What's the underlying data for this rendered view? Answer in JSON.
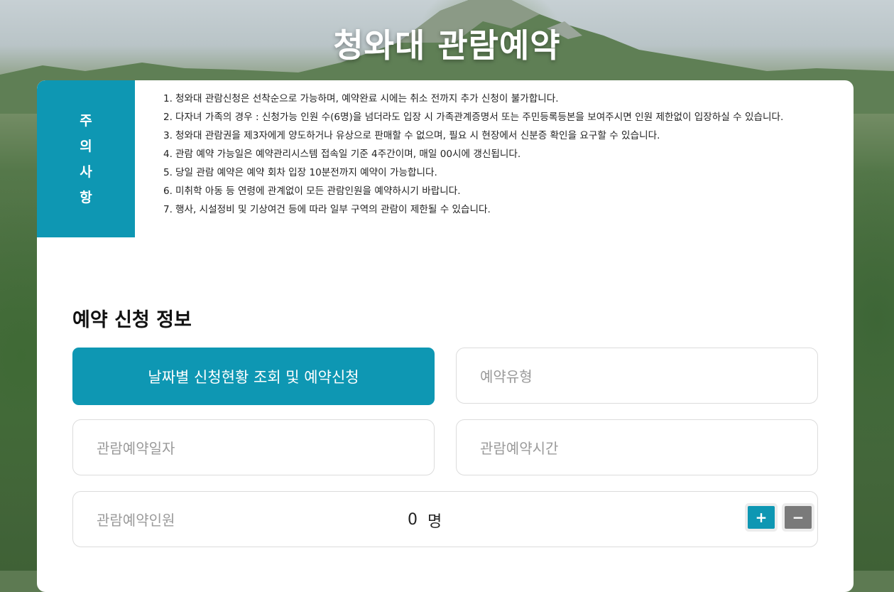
{
  "page": {
    "title": "청와대 관람예약"
  },
  "notice": {
    "tab_chars": [
      "주",
      "의",
      "사",
      "항"
    ],
    "items": [
      {
        "num": "1.",
        "text": "청와대 관람신청은 선착순으로 가능하며, 예약완료 시에는 취소 전까지 추가 신청이 불가합니다."
      },
      {
        "num": "2.",
        "text": "다자녀 가족의 경우 : 신청가능 인원 수(6명)을 넘더라도 입장 시 가족관계증명서 또는 주민등록등본을 보여주시면 인원 제한없이 입장하실 수 있습니다."
      },
      {
        "num": "3.",
        "text": "청와대 관람권을 제3자에게 양도하거나 유상으로 판매할 수 없으며, 필요 시 현장에서 신분증 확인을 요구할 수 있습니다."
      },
      {
        "num": "4.",
        "text": "관람 예약 가능일은 예약관리시스템 접속일 기준 4주간이며, 매일 00시에 갱신됩니다."
      },
      {
        "num": "5.",
        "text": "당일 관람 예약은 예약 회차 입장 10분전까지 예약이 가능합니다."
      },
      {
        "num": "6.",
        "text": "미취학 아동 등 연령에 관계없이 모든 관람인원을 예약하시기 바랍니다."
      },
      {
        "num": "7.",
        "text": "행사, 시설정비 및 기상여건 등에 따라 일부 구역의 관람이 제한될 수 있습니다."
      }
    ]
  },
  "form": {
    "section_title": "예약 신청 정보",
    "date_lookup_button": "날짜별 신청현황 조회 및 예약신청",
    "type_label": "예약유형",
    "date_label": "관람예약일자",
    "time_label": "관람예약시간",
    "count_label": "관람예약인원",
    "count_value": "0",
    "count_unit": "명",
    "plus_symbol": "+",
    "minus_symbol": "−"
  },
  "colors": {
    "accent": "#0e97b3",
    "minus_button": "#7a7a7a"
  }
}
